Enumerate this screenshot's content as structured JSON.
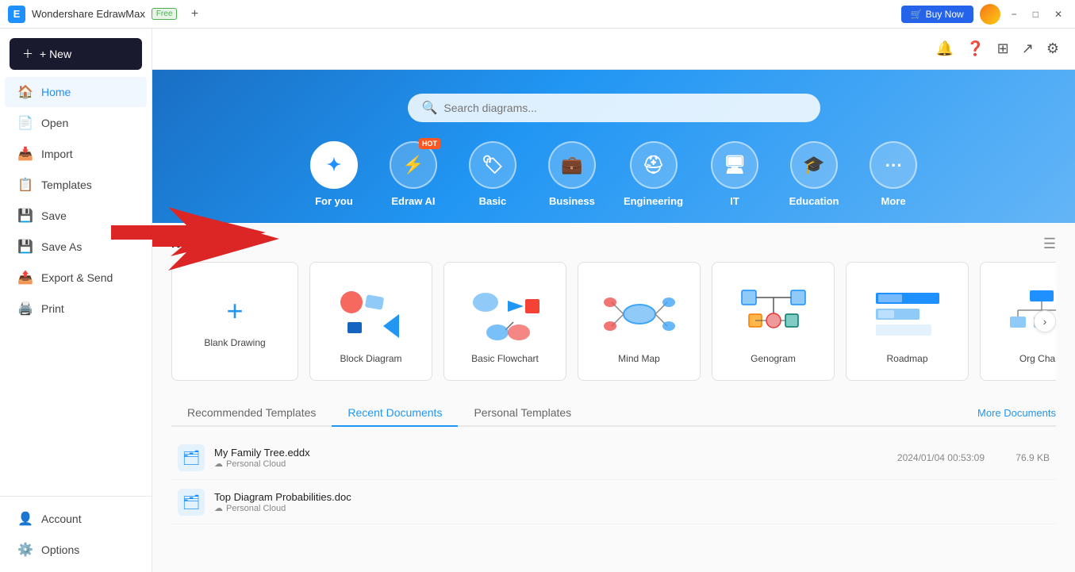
{
  "titlebar": {
    "app_name": "Wondershare EdrawMax",
    "free_label": "Free",
    "buy_now": "Buy Now"
  },
  "sidebar": {
    "new_btn": "+ New",
    "items": [
      {
        "id": "home",
        "label": "Home",
        "icon": "🏠",
        "active": true
      },
      {
        "id": "open",
        "label": "Open",
        "icon": "📄"
      },
      {
        "id": "import",
        "label": "Import",
        "icon": "📥"
      },
      {
        "id": "templates",
        "label": "Templates",
        "icon": "📋"
      },
      {
        "id": "save",
        "label": "Save",
        "icon": "💾"
      },
      {
        "id": "save-as",
        "label": "Save As",
        "icon": "💾"
      },
      {
        "id": "export-send",
        "label": "Export & Send",
        "icon": "📤"
      },
      {
        "id": "print",
        "label": "Print",
        "icon": "🖨️"
      }
    ],
    "bottom_items": [
      {
        "id": "account",
        "label": "Account",
        "icon": "👤"
      },
      {
        "id": "options",
        "label": "Options",
        "icon": "⚙️"
      }
    ]
  },
  "hero": {
    "search_placeholder": "Search diagrams...",
    "categories": [
      {
        "id": "for-you",
        "label": "For you",
        "icon": "✦",
        "active": true
      },
      {
        "id": "edraw-ai",
        "label": "Edraw AI",
        "icon": "⚡",
        "hot": true
      },
      {
        "id": "basic",
        "label": "Basic",
        "icon": "🏷️"
      },
      {
        "id": "business",
        "label": "Business",
        "icon": "💼"
      },
      {
        "id": "engineering",
        "label": "Engineering",
        "icon": "⛑️"
      },
      {
        "id": "it",
        "label": "IT",
        "icon": "🖥️"
      },
      {
        "id": "education",
        "label": "Education",
        "icon": "🎓"
      },
      {
        "id": "more",
        "label": "More",
        "icon": "⋯"
      }
    ]
  },
  "new_section": {
    "title": "New",
    "blank_label": "Blank Drawing",
    "templates": [
      {
        "id": "block-diagram",
        "label": "Block Diagram"
      },
      {
        "id": "basic-flowchart",
        "label": "Basic Flowchart"
      },
      {
        "id": "mind-map",
        "label": "Mind Map"
      },
      {
        "id": "genogram",
        "label": "Genogram"
      },
      {
        "id": "roadmap",
        "label": "Roadmap"
      },
      {
        "id": "org-chart",
        "label": "Org Cha..."
      }
    ]
  },
  "tabs": {
    "items": [
      {
        "id": "recommended",
        "label": "Recommended Templates"
      },
      {
        "id": "recent",
        "label": "Recent Documents",
        "active": true
      },
      {
        "id": "personal",
        "label": "Personal Templates"
      }
    ],
    "more_docs": "More Documents"
  },
  "documents": [
    {
      "name": "My Family Tree.eddx",
      "location": "Personal Cloud",
      "date": "2024/01/04 00:53:09",
      "size": "76.9 KB"
    },
    {
      "name": "Top Diagram Probabilities.doc",
      "location": "Personal Cloud",
      "date": "",
      "size": ""
    }
  ]
}
